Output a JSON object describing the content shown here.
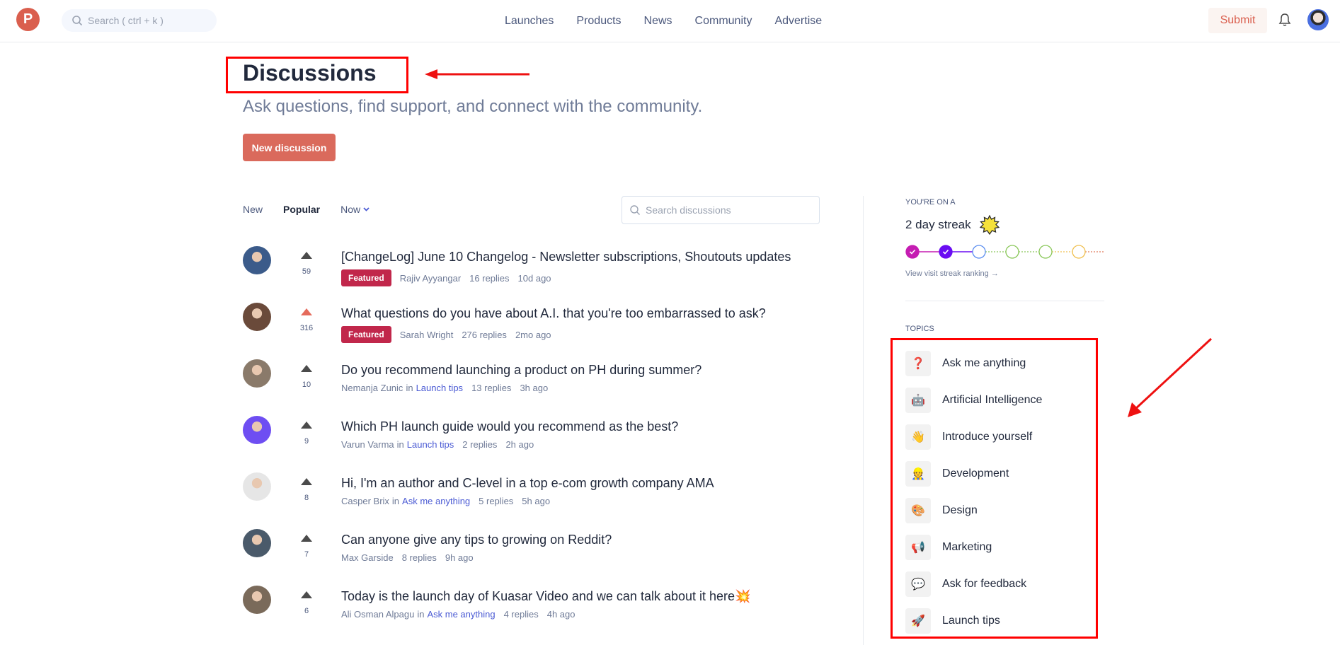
{
  "header": {
    "logo_letter": "P",
    "search_placeholder": "Search ( ctrl + k )",
    "nav": [
      "Launches",
      "Products",
      "News",
      "Community",
      "Advertise"
    ],
    "submit_label": "Submit"
  },
  "page": {
    "title": "Discussions",
    "subtitle": "Ask questions, find support, and connect with the community.",
    "new_discussion_label": "New discussion"
  },
  "filters": {
    "tabs": [
      "New",
      "Popular"
    ],
    "active_tab": "Popular",
    "time_filter": "Now",
    "search_placeholder": "Search discussions"
  },
  "discussions": [
    {
      "title": "[ChangeLog] June 10 Changelog - Newsletter subscriptions, Shoutouts updates",
      "votes": "59",
      "upvoted": false,
      "featured": true,
      "badge": "Featured",
      "author": "Rajiv Ayyangar",
      "topic": "",
      "replies": "16 replies",
      "age": "10d ago",
      "avatar_color": "#3b5b8a"
    },
    {
      "title": "What questions do you have about A.I. that you're too embarrassed to ask?",
      "votes": "316",
      "upvoted": true,
      "featured": true,
      "badge": "Featured",
      "author": "Sarah Wright",
      "topic": "",
      "replies": "276 replies",
      "age": "2mo ago",
      "avatar_color": "#6a4a3a"
    },
    {
      "title": "Do you recommend launching a product on PH during summer?",
      "votes": "10",
      "upvoted": false,
      "featured": false,
      "badge": "",
      "author": "Nemanja Zunic",
      "topic": "Launch tips",
      "replies": "13 replies",
      "age": "3h ago",
      "avatar_color": "#8a7a6a"
    },
    {
      "title": "Which PH launch guide would you recommend as the best?",
      "votes": "9",
      "upvoted": false,
      "featured": false,
      "badge": "",
      "author": "Varun Varma",
      "topic": "Launch tips",
      "replies": "2 replies",
      "age": "2h ago",
      "avatar_color": "#6e4ef2"
    },
    {
      "title": "Hi, I'm an author and C-level in a top e-com growth company AMA",
      "votes": "8",
      "upvoted": false,
      "featured": false,
      "badge": "",
      "author": "Casper Brix",
      "topic": "Ask me anything",
      "replies": "5 replies",
      "age": "5h ago",
      "avatar_color": "#e6e6e6"
    },
    {
      "title": "Can anyone give any tips to growing on Reddit?",
      "votes": "7",
      "upvoted": false,
      "featured": false,
      "badge": "",
      "author": "Max Garside",
      "topic": "",
      "replies": "8 replies",
      "age": "9h ago",
      "avatar_color": "#4a5a6a"
    },
    {
      "title": "Today is the launch day of Kuasar Video and we can talk about it here💥",
      "votes": "6",
      "upvoted": false,
      "featured": false,
      "badge": "",
      "author": "Ali Osman Alpagu",
      "topic": "Ask me anything",
      "replies": "4 replies",
      "age": "4h ago",
      "avatar_color": "#7a6a5a"
    }
  ],
  "in_label": "in",
  "streak": {
    "label": "YOU'RE ON A",
    "title": "2 day streak",
    "days_completed": 2,
    "total_days_shown": 6,
    "dot_colors": [
      "#c51db2",
      "#6a0df2",
      "#5b8ef0",
      "#8ac85a",
      "#8ac85a",
      "#f0c050"
    ],
    "link": "View visit streak ranking →"
  },
  "topics": {
    "label": "TOPICS",
    "items": [
      {
        "name": "Ask me anything",
        "icon": "❓",
        "icon_name": "question-mark-icon"
      },
      {
        "name": "Artificial Intelligence",
        "icon": "🤖",
        "icon_name": "robot-icon"
      },
      {
        "name": "Introduce yourself",
        "icon": "👋",
        "icon_name": "waving-hand-icon"
      },
      {
        "name": "Development",
        "icon": "👷",
        "icon_name": "developer-icon"
      },
      {
        "name": "Design",
        "icon": "🎨",
        "icon_name": "palette-icon"
      },
      {
        "name": "Marketing",
        "icon": "📢",
        "icon_name": "megaphone-icon"
      },
      {
        "name": "Ask for feedback",
        "icon": "💬",
        "icon_name": "speech-bubble-icon"
      },
      {
        "name": "Launch tips",
        "icon": "🚀",
        "icon_name": "rocket-icon"
      }
    ]
  }
}
